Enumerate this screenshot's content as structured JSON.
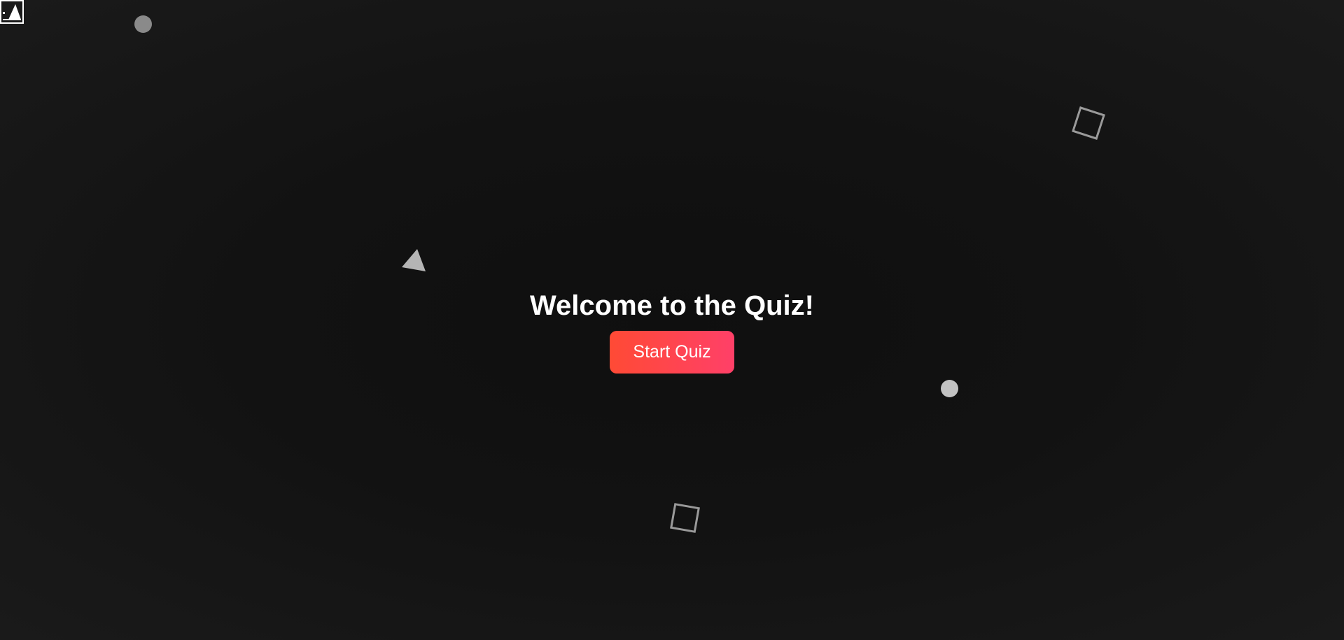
{
  "page": {
    "title": "Welcome to the Quiz!",
    "start_button_label": "Start Quiz"
  },
  "background": {
    "base_color": "#121212",
    "decorations": [
      "circle",
      "square-outline",
      "triangle",
      "circle",
      "square-outline"
    ]
  },
  "colors": {
    "button_gradient_start": "#ff4a35",
    "button_gradient_end": "#ff4068",
    "text": "#ffffff",
    "shape_fill": "#8c8c8c"
  },
  "icons": {
    "broken_image": "broken-image-icon"
  }
}
